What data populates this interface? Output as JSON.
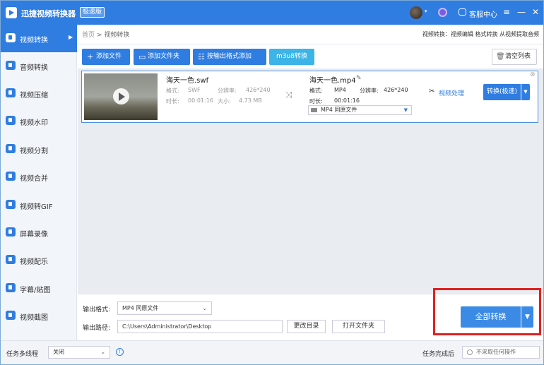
{
  "app": {
    "title": "迅捷视频转换器",
    "badge": "极速版",
    "service": "客服中心"
  },
  "sidebar": {
    "items": [
      {
        "label": "视频转换",
        "icon": "video-convert-icon"
      },
      {
        "label": "音频转换",
        "icon": "audio-convert-icon"
      },
      {
        "label": "视频压缩",
        "icon": "compress-icon"
      },
      {
        "label": "视频水印",
        "icon": "watermark-icon"
      },
      {
        "label": "视频分割",
        "icon": "split-icon"
      },
      {
        "label": "视频合并",
        "icon": "merge-icon"
      },
      {
        "label": "视频转GIF",
        "icon": "gif-icon"
      },
      {
        "label": "屏幕录像",
        "icon": "screen-record-icon"
      },
      {
        "label": "视频配乐",
        "icon": "music-icon"
      },
      {
        "label": "字幕/贴图",
        "icon": "subtitle-icon"
      },
      {
        "label": "视频截图",
        "icon": "screenshot-icon"
      }
    ]
  },
  "breadcrumb": {
    "home": "首页",
    "sep": ">",
    "current": "视频转换"
  },
  "header_links": "视频转换：视频编辑 格式转换 从视频提取音频",
  "toolbar": {
    "add_file": "添加文件",
    "add_folder": "添加文件夹",
    "add_by_format": "按输出格式添加",
    "m3u8": "m3u8转换",
    "clear": "清空列表"
  },
  "file": {
    "src_name": "海天一色.swf",
    "label_format": "格式:",
    "label_resolution": "分辨率:",
    "label_duration": "时长:",
    "label_size": "大小:",
    "src_format": "SWF",
    "src_resolution": "426*240",
    "src_duration": "00:01:16",
    "src_size": "4.73 MB",
    "dst_name": "海天一色.mp4",
    "dst_format": "MP4",
    "dst_resolution": "426*240",
    "dst_duration": "00:01:16",
    "dst_select": "MP4  同原文件",
    "process": "视频处理",
    "convert": "转换(极速)"
  },
  "bottom": {
    "format_label": "输出格式:",
    "format_value": "MP4  同原文件",
    "path_label": "输出路径:",
    "path_value": "C:\\Users\\Administrator\\Desktop",
    "change_dir": "更改目录",
    "open_folder": "打开文件夹",
    "convert_all": "全部转换"
  },
  "status": {
    "multi_label": "任务多线程",
    "multi_value": "关闭",
    "done_label": "任务完成后",
    "done_value": "不采取任何操作"
  },
  "colors": {
    "primary": "#2f7de1",
    "highlight": "#e02020"
  }
}
